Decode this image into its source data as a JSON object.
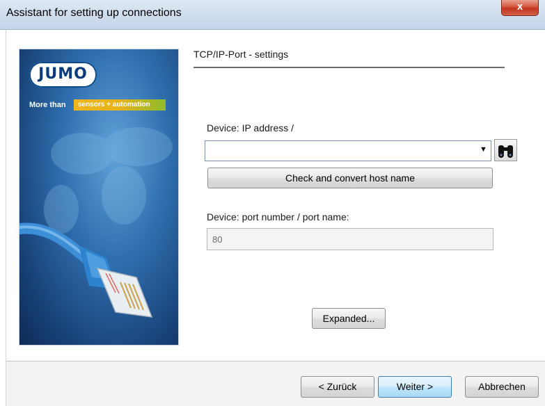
{
  "window": {
    "title": "Assistant for setting up connections",
    "close_label": "x"
  },
  "banner": {
    "logo_text": "JUMO",
    "tagline": "More than",
    "tag_chip": "sensors + automation"
  },
  "settings": {
    "section_title": "TCP/IP-Port - settings",
    "ip_label": "Device: IP address /",
    "ip_value": "",
    "check_button": "Check and convert host name",
    "port_label": "Device:  port number / port name:",
    "port_value": "80",
    "expanded_button": "Expanded..."
  },
  "footer": {
    "back_button": "< Zurück",
    "next_button": "Weiter >",
    "cancel_button": "Abbrechen"
  },
  "colors": {
    "accent_blue": "#3c7fb1",
    "logo_blue": "#0b3c7d",
    "tag_yellow": "#f1b51d",
    "tag_green": "#8dbd2a"
  }
}
